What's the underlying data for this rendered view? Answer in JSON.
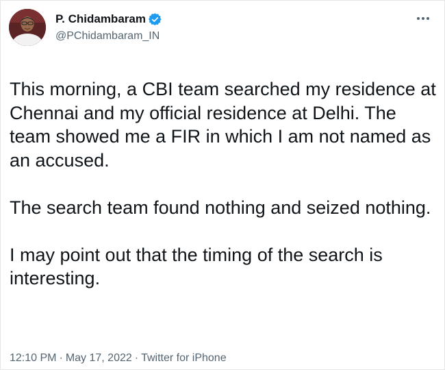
{
  "tweet": {
    "author": {
      "display_name": "P. Chidambaram",
      "handle": "@PChidambaram_IN",
      "verified": true
    },
    "more_icon": "more-horizontal-icon",
    "paragraphs": [
      "This morning, a CBI team searched my residence at Chennai and my official residence at Delhi. The team showed me a FIR in which I am not named as an accused.",
      "The search team found nothing and seized nothing.",
      "I may point out that the timing of the search is interesting."
    ],
    "time": "12:10 PM",
    "date": "May 17, 2022",
    "source": "Twitter for iPhone",
    "separator": "·"
  },
  "colors": {
    "text": "#0f1419",
    "secondary": "#536471",
    "verified": "#1d9bf0"
  }
}
